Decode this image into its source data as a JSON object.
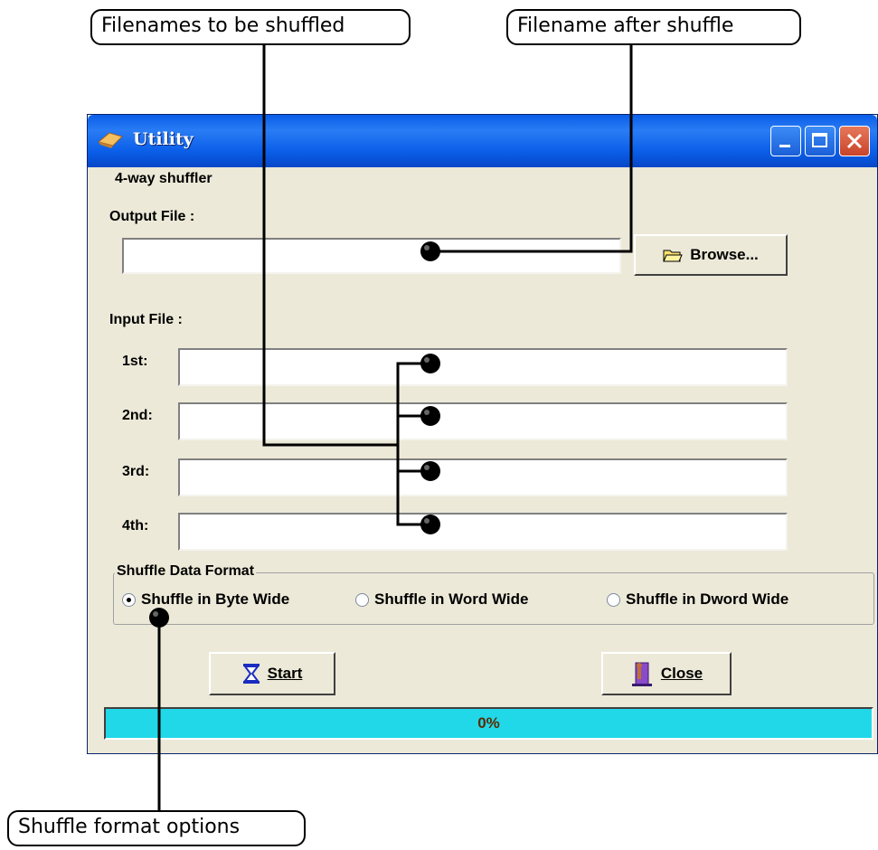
{
  "callouts": {
    "filenames_to_be_shuffled": "Filenames to be shuffled",
    "filename_after_shuffle": "Filename after shuffle",
    "shuffle_format_options": "Shuffle format options"
  },
  "window": {
    "title": "Utility",
    "group_label": "4-way shuffler",
    "output_file_label": "Output File :",
    "output_file_value": "",
    "browse_button": "Browse...",
    "input_file_label": "Input File :",
    "inputs": [
      {
        "label": "1st:",
        "value": ""
      },
      {
        "label": "2nd:",
        "value": ""
      },
      {
        "label": "3rd:",
        "value": ""
      },
      {
        "label": "4th:",
        "value": ""
      }
    ],
    "shuffle_format": {
      "label": "Shuffle Data Format",
      "options": [
        {
          "label": "Shuffle in Byte Wide",
          "selected": true
        },
        {
          "label": "Shuffle in Word Wide",
          "selected": false
        },
        {
          "label": "Shuffle in Dword Wide",
          "selected": false
        }
      ]
    },
    "start_button": "Start",
    "close_button": "Close",
    "progress": {
      "percent": 0,
      "text": "0%"
    }
  },
  "colors": {
    "titlebar": "#0a5ee8",
    "dialog_bg": "#ece9d8",
    "progress": "#21d8e8"
  }
}
